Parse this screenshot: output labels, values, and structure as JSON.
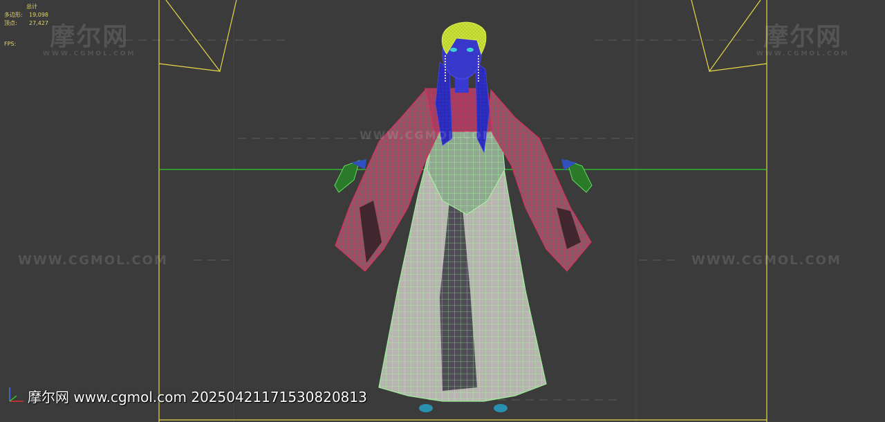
{
  "viewport": {
    "stats_header": "总计",
    "polygons_label": "多边形:",
    "polygons_value": "19,098",
    "vertices_label": "顶点:",
    "vertices_value": "27,427",
    "fps_label": "FPS:"
  },
  "watermarks": {
    "logo_cn": "摩尔网",
    "logo_en": "WWW.CGMOL.COM",
    "url": "WWW.CGMOL.COM",
    "bottom_caption": "摩尔网 www.cgmol.com 20250421171530820813"
  },
  "colors": {
    "frame_yellow": "#e8d84a",
    "horizon_green": "#33cc33",
    "sleeve_red": "#c2305a",
    "skirt_green": "#9cf09a",
    "hair_blue": "#2a2ab8",
    "hair_yellow": "#c8e040"
  },
  "icons": [
    "axis-gizmo-icon"
  ]
}
